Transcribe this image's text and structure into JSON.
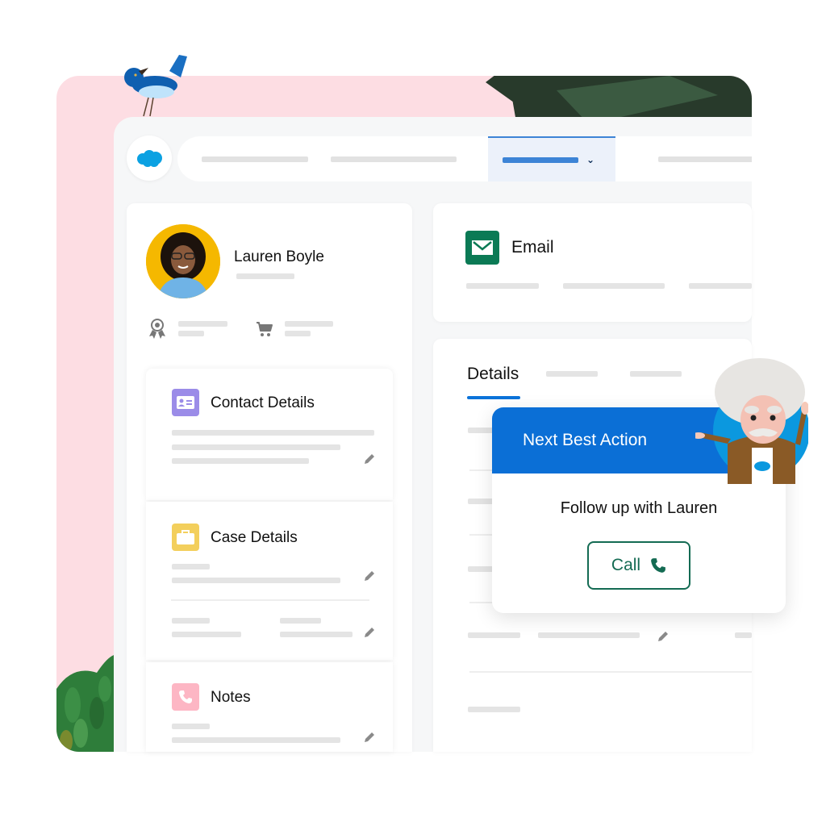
{
  "app": {
    "brand_icon": "salesforce-cloud-icon",
    "colors": {
      "backdrop_pink": "#fddde3",
      "accent_blue": "#0b6fd6",
      "nav_active_blue": "#3d84d6",
      "email_green": "#0b7a55",
      "call_green": "#146b53",
      "contact_purple": "#9b8ce8",
      "case_yellow": "#f3cf5c",
      "notes_pink": "#fdb6c4"
    }
  },
  "nav": {
    "items": [
      {
        "label": "",
        "active": false
      },
      {
        "label": "",
        "active": false
      },
      {
        "label": "",
        "active": true,
        "icon": "chevron-down-icon"
      },
      {
        "label": "",
        "active": false
      }
    ]
  },
  "profile": {
    "name": "Lauren Boyle",
    "stats": [
      {
        "icon": "award-ribbon-icon"
      },
      {
        "icon": "shopping-cart-icon"
      }
    ]
  },
  "sections": {
    "contact": {
      "title": "Contact Details",
      "icon": "contact-card-icon"
    },
    "case": {
      "title": "Case Details",
      "icon": "briefcase-icon"
    },
    "notes": {
      "title": "Notes",
      "icon": "phone-icon"
    }
  },
  "email": {
    "title": "Email",
    "icon": "envelope-icon"
  },
  "details": {
    "tabs": [
      {
        "label": "Details",
        "active": true
      },
      {
        "label": "",
        "active": false
      },
      {
        "label": "",
        "active": false
      }
    ]
  },
  "next_best_action": {
    "title": "Next Best Action",
    "message": "Follow up with Lauren",
    "button_label": "Call",
    "button_icon": "phone-icon"
  }
}
